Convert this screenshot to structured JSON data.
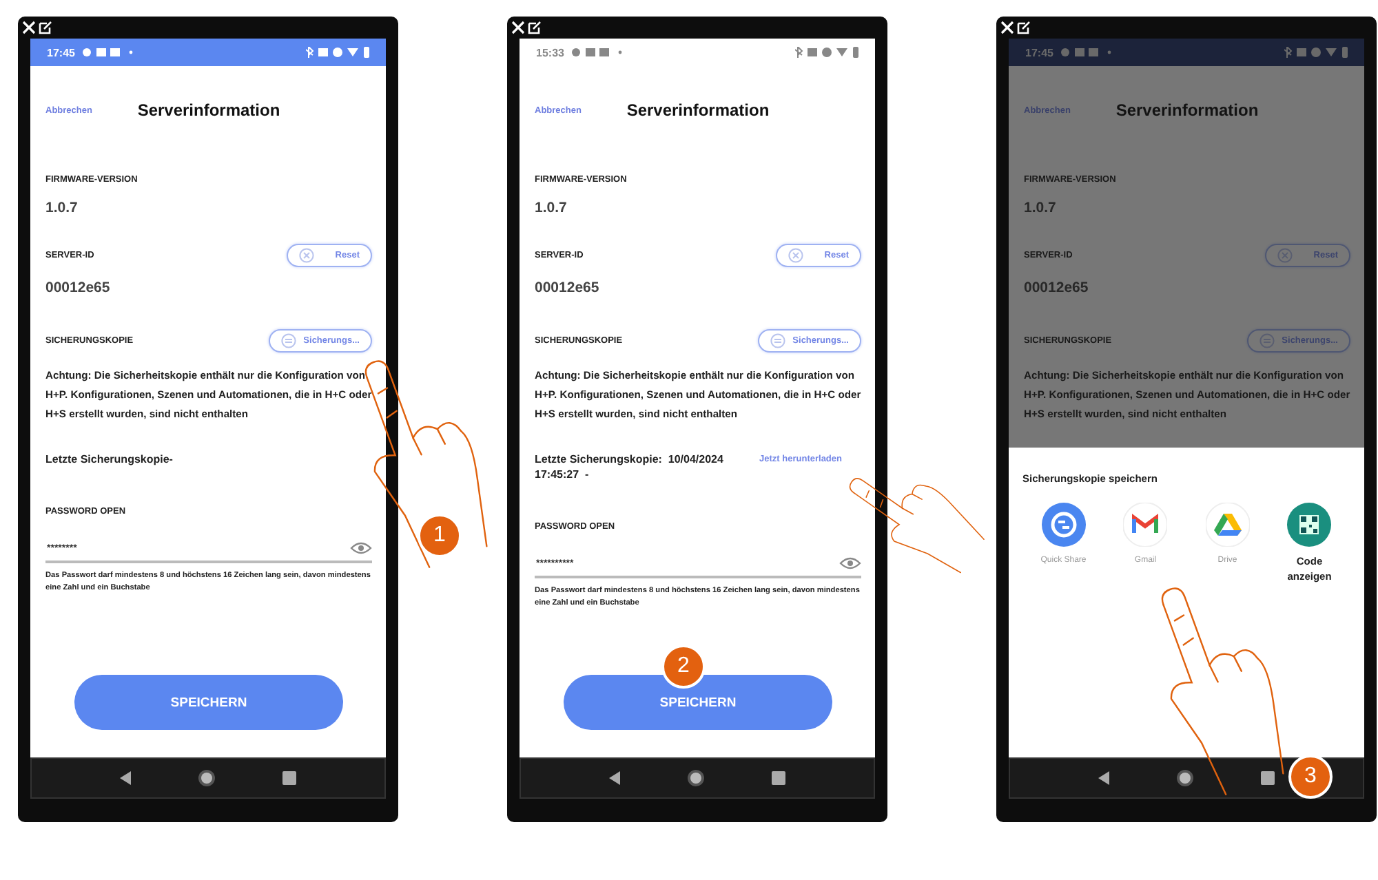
{
  "screens": [
    {
      "status_bar": {
        "time": "17:45"
      },
      "cancel": "Abbrechen",
      "title": "Serverinformation",
      "firmware_label": "FIRMWARE-VERSION",
      "firmware": "1.0.7",
      "server_id_label": "SERVER-ID",
      "server_id": "00012e65",
      "reset_button": "Reset",
      "backup_label": "SICHERUNGSKOPIE",
      "backup_button": "Sicherungs...",
      "warning": "Achtung: Die Sicherheitskopie enthält nur die Konfiguration von H+P. Konfigurationen, Szenen und Automationen, die in H+C oder H+S erstellt wurden, sind nicht enthalten",
      "last_backup": "Letzte Sicherungskopie-",
      "password_label": "PASSWORD OPEN",
      "password": "********",
      "password_hint": "Das Passwort darf mindestens 8 und höchstens 16 Zeichen lang sein, davon mindestens eine Zahl und ein Buchstabe",
      "save_button": "SPEICHERN",
      "dimmed": false,
      "step": "1"
    },
    {
      "status_bar": {
        "time": "15:33"
      },
      "cancel": "Abbrechen",
      "title": "Serverinformation",
      "firmware_label": "FIRMWARE-VERSION",
      "firmware": "1.0.7",
      "server_id_label": "SERVER-ID",
      "server_id": "00012e65",
      "reset_button": "Reset",
      "backup_label": "SICHERUNGSKOPIE",
      "backup_button": "Sicherungs...",
      "warning": "Achtung: Die Sicherheitskopie enthält nur die Konfiguration von H+P. Konfigurationen, Szenen und Automationen, die in H+C oder H+S erstellt wurden, sind nicht enthalten",
      "last_backup": "Letzte Sicherungskopie:  10/04/2024 17:45:27  -",
      "download_link": "Jetzt herunterladen",
      "password_label": "PASSWORD OPEN",
      "password": "**********",
      "password_hint": "Das Passwort darf mindestens 8 und höchstens 16 Zeichen lang sein, davon mindestens eine Zahl und ein Buchstabe",
      "save_button": "SPEICHERN",
      "dimmed": false,
      "step": "2"
    },
    {
      "status_bar": {
        "time": "17:45"
      },
      "cancel": "Abbrechen",
      "title": "Serverinformation",
      "firmware_label": "FIRMWARE-VERSION",
      "firmware": "1.0.7",
      "server_id_label": "SERVER-ID",
      "server_id": "00012e65",
      "reset_button": "Reset",
      "backup_label": "SICHERUNGSKOPIE",
      "backup_button": "Sicherungs...",
      "warning": "Achtung: Die Sicherheitskopie enthält nur die Konfiguration von H+P. Konfigurationen, Szenen und Automationen, die in H+C oder H+S erstellt wurden, sind nicht enthalten",
      "dimmed": true,
      "share_sheet": {
        "title": "Sicherungskopie speichern",
        "apps": [
          {
            "kind": "quickshare",
            "label": "Quick Share"
          },
          {
            "kind": "gmail",
            "label": "Gmail"
          },
          {
            "kind": "drive",
            "label": "Drive"
          },
          {
            "kind": "qrcode",
            "label": "Code anzeigen"
          }
        ]
      },
      "step": "3"
    }
  ]
}
